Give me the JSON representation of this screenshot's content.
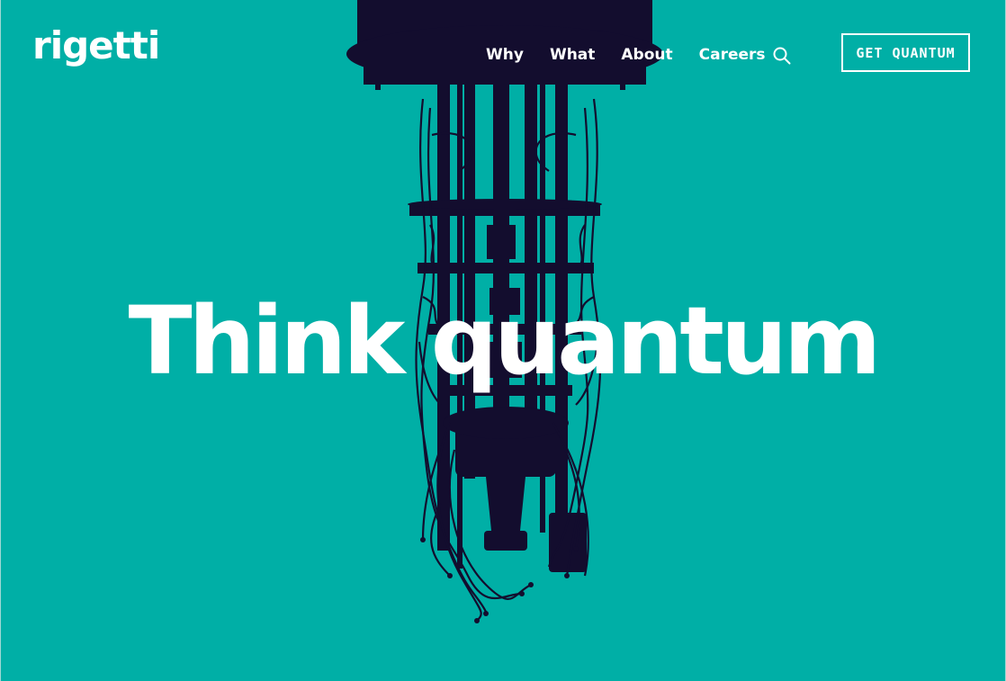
{
  "brand": {
    "logo_text": "rigetti"
  },
  "nav": {
    "items": [
      {
        "label": "Why"
      },
      {
        "label": "What"
      },
      {
        "label": "About"
      },
      {
        "label": "Careers"
      }
    ],
    "search_icon": "search-icon",
    "cta_label": "GET QUANTUM"
  },
  "hero": {
    "title": "Think quantum",
    "illustration": "dilution-refrigerator-silhouette"
  },
  "colors": {
    "background": "#00AFA6",
    "silhouette": "#130D2E",
    "text": "#FFFFFF"
  }
}
